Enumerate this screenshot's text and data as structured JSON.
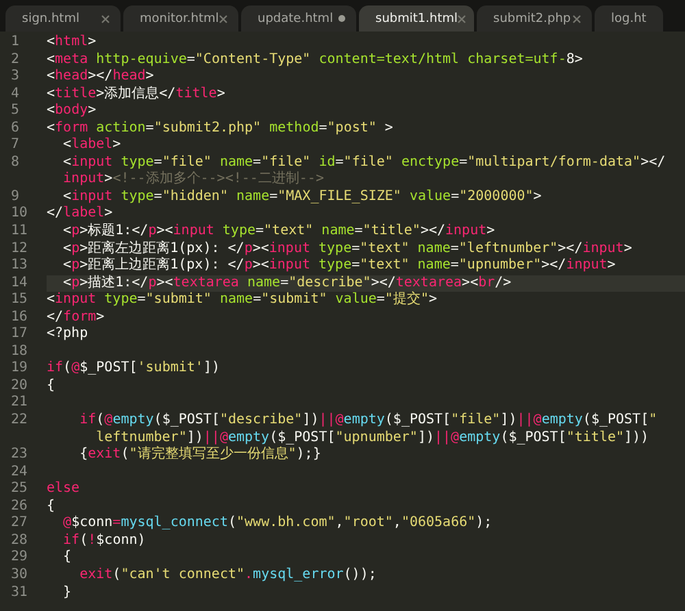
{
  "tabs": [
    {
      "label": "sign.html",
      "selected": false,
      "modified": false
    },
    {
      "label": "monitor.html",
      "selected": false,
      "modified": false
    },
    {
      "label": "update.html",
      "selected": false,
      "modified": true
    },
    {
      "label": "submit1.html",
      "selected": true,
      "modified": false
    },
    {
      "label": "submit2.php",
      "selected": false,
      "modified": false
    },
    {
      "label": "log.ht",
      "selected": false,
      "kind": "cut"
    }
  ],
  "lines": [
    {
      "number": "1",
      "current": false,
      "tokens": [
        {
          "kind": "p",
          "text": "<"
        },
        {
          "kind": "tag",
          "text": "html"
        },
        {
          "kind": "p",
          "text": ">"
        }
      ]
    },
    {
      "number": "2",
      "current": false,
      "tokens": [
        {
          "kind": "p",
          "text": "<"
        },
        {
          "kind": "tag",
          "text": "meta"
        },
        {
          "kind": "attr",
          "text": " http-equive"
        },
        {
          "kind": "p",
          "text": "="
        },
        {
          "kind": "str",
          "text": "\"Content-Type\""
        },
        {
          "kind": "attr",
          "text": " content=text/html charset=utf-"
        },
        {
          "kind": "p",
          "text": "8>"
        }
      ]
    },
    {
      "number": "3",
      "current": false,
      "tokens": [
        {
          "kind": "p",
          "text": "<"
        },
        {
          "kind": "tag",
          "text": "head"
        },
        {
          "kind": "p",
          "text": "></"
        },
        {
          "kind": "tag",
          "text": "head"
        },
        {
          "kind": "p",
          "text": ">"
        }
      ]
    },
    {
      "number": "4",
      "current": false,
      "tokens": [
        {
          "kind": "p",
          "text": "<"
        },
        {
          "kind": "tag",
          "text": "title"
        },
        {
          "kind": "p",
          "text": ">添加信息</"
        },
        {
          "kind": "tag",
          "text": "title"
        },
        {
          "kind": "p",
          "text": ">"
        }
      ]
    },
    {
      "number": "5",
      "current": false,
      "tokens": [
        {
          "kind": "p",
          "text": "<"
        },
        {
          "kind": "tag",
          "text": "body"
        },
        {
          "kind": "p",
          "text": ">"
        }
      ]
    },
    {
      "number": "6",
      "current": false,
      "tokens": [
        {
          "kind": "p",
          "text": "<"
        },
        {
          "kind": "tag",
          "text": "form"
        },
        {
          "kind": "attr",
          "text": " action"
        },
        {
          "kind": "p",
          "text": "="
        },
        {
          "kind": "str",
          "text": "\"submit2.php\""
        },
        {
          "kind": "attr",
          "text": " method"
        },
        {
          "kind": "p",
          "text": "="
        },
        {
          "kind": "str",
          "text": "\"post\""
        },
        {
          "kind": "p",
          "text": " >"
        }
      ]
    },
    {
      "number": "7",
      "current": false,
      "tokens": [
        {
          "kind": "p",
          "text": "  <"
        },
        {
          "kind": "tag",
          "text": "label"
        },
        {
          "kind": "p",
          "text": ">"
        }
      ]
    },
    {
      "number": "8",
      "current": false,
      "tokens": [
        {
          "kind": "p",
          "text": "  <"
        },
        {
          "kind": "tag",
          "text": "input"
        },
        {
          "kind": "attr",
          "text": " type"
        },
        {
          "kind": "p",
          "text": "="
        },
        {
          "kind": "str",
          "text": "\"file\""
        },
        {
          "kind": "attr",
          "text": " name"
        },
        {
          "kind": "p",
          "text": "="
        },
        {
          "kind": "str",
          "text": "\"file\""
        },
        {
          "kind": "attr",
          "text": " id"
        },
        {
          "kind": "p",
          "text": "="
        },
        {
          "kind": "str",
          "text": "\"file\""
        },
        {
          "kind": "attr",
          "text": " enctype"
        },
        {
          "kind": "p",
          "text": "="
        },
        {
          "kind": "str",
          "text": "\"multipart/form-data\""
        },
        {
          "kind": "p",
          "text": "></"
        }
      ],
      "wrap": [
        {
          "kind": "tag",
          "text": "  input"
        },
        {
          "kind": "p",
          "text": ">"
        },
        {
          "kind": "cmt",
          "text": "<!--添加多个--><!--二进制-->"
        }
      ]
    },
    {
      "number": "9",
      "current": false,
      "tokens": [
        {
          "kind": "p",
          "text": "  <"
        },
        {
          "kind": "tag",
          "text": "input"
        },
        {
          "kind": "attr",
          "text": " type"
        },
        {
          "kind": "p",
          "text": "="
        },
        {
          "kind": "str",
          "text": "\"hidden\""
        },
        {
          "kind": "attr",
          "text": " name"
        },
        {
          "kind": "p",
          "text": "="
        },
        {
          "kind": "str",
          "text": "\"MAX_FILE_SIZE\""
        },
        {
          "kind": "attr",
          "text": " value"
        },
        {
          "kind": "p",
          "text": "="
        },
        {
          "kind": "str",
          "text": "\"2000000\""
        },
        {
          "kind": "p",
          "text": ">"
        }
      ]
    },
    {
      "number": "10",
      "current": false,
      "tokens": [
        {
          "kind": "p",
          "text": "</"
        },
        {
          "kind": "tag",
          "text": "label"
        },
        {
          "kind": "p",
          "text": ">"
        }
      ]
    },
    {
      "number": "11",
      "current": false,
      "tokens": [
        {
          "kind": "p",
          "text": "  <"
        },
        {
          "kind": "tag",
          "text": "p"
        },
        {
          "kind": "p",
          "text": ">标题1:</"
        },
        {
          "kind": "tag",
          "text": "p"
        },
        {
          "kind": "p",
          "text": "><"
        },
        {
          "kind": "tag",
          "text": "input"
        },
        {
          "kind": "attr",
          "text": " type"
        },
        {
          "kind": "p",
          "text": "="
        },
        {
          "kind": "str",
          "text": "\"text\""
        },
        {
          "kind": "attr",
          "text": " name"
        },
        {
          "kind": "p",
          "text": "="
        },
        {
          "kind": "str",
          "text": "\"title\""
        },
        {
          "kind": "p",
          "text": "></"
        },
        {
          "kind": "tag",
          "text": "input"
        },
        {
          "kind": "p",
          "text": ">"
        }
      ]
    },
    {
      "number": "12",
      "current": false,
      "tokens": [
        {
          "kind": "p",
          "text": "  <"
        },
        {
          "kind": "tag",
          "text": "p"
        },
        {
          "kind": "p",
          "text": ">距离左边距离1(px): </"
        },
        {
          "kind": "tag",
          "text": "p"
        },
        {
          "kind": "p",
          "text": "><"
        },
        {
          "kind": "tag",
          "text": "input"
        },
        {
          "kind": "attr",
          "text": " type"
        },
        {
          "kind": "p",
          "text": "="
        },
        {
          "kind": "str",
          "text": "\"text\""
        },
        {
          "kind": "attr",
          "text": " name"
        },
        {
          "kind": "p",
          "text": "="
        },
        {
          "kind": "str",
          "text": "\"leftnumber\""
        },
        {
          "kind": "p",
          "text": "></"
        },
        {
          "kind": "tag",
          "text": "input"
        },
        {
          "kind": "p",
          "text": ">"
        }
      ]
    },
    {
      "number": "13",
      "current": false,
      "tokens": [
        {
          "kind": "p",
          "text": "  <"
        },
        {
          "kind": "tag",
          "text": "p"
        },
        {
          "kind": "p",
          "text": ">距离上边距离1(px): </"
        },
        {
          "kind": "tag",
          "text": "p"
        },
        {
          "kind": "p",
          "text": "><"
        },
        {
          "kind": "tag",
          "text": "input"
        },
        {
          "kind": "attr",
          "text": " type"
        },
        {
          "kind": "p",
          "text": "="
        },
        {
          "kind": "str",
          "text": "\"text\""
        },
        {
          "kind": "attr",
          "text": " name"
        },
        {
          "kind": "p",
          "text": "="
        },
        {
          "kind": "str",
          "text": "\"upnumber\""
        },
        {
          "kind": "p",
          "text": "></"
        },
        {
          "kind": "tag",
          "text": "input"
        },
        {
          "kind": "p",
          "text": ">"
        }
      ]
    },
    {
      "number": "14",
      "current": true,
      "tokens": [
        {
          "kind": "p",
          "text": "  <"
        },
        {
          "kind": "tag",
          "text": "p"
        },
        {
          "kind": "p",
          "text": ">描述1:</"
        },
        {
          "kind": "tag",
          "text": "p"
        },
        {
          "kind": "p",
          "text": "><"
        },
        {
          "kind": "tag",
          "text": "textarea"
        },
        {
          "kind": "attr",
          "text": " name"
        },
        {
          "kind": "p",
          "text": "="
        },
        {
          "kind": "str",
          "text": "\"describe\""
        },
        {
          "kind": "p",
          "text": "></"
        },
        {
          "kind": "tag",
          "text": "textarea"
        },
        {
          "kind": "p",
          "text": "><"
        },
        {
          "kind": "tag",
          "text": "br"
        },
        {
          "kind": "p",
          "text": "/>"
        }
      ]
    },
    {
      "number": "15",
      "current": false,
      "tokens": [
        {
          "kind": "p",
          "text": "<"
        },
        {
          "kind": "tag",
          "text": "input"
        },
        {
          "kind": "attr",
          "text": " type"
        },
        {
          "kind": "p",
          "text": "="
        },
        {
          "kind": "str",
          "text": "\"submit\""
        },
        {
          "kind": "attr",
          "text": " name"
        },
        {
          "kind": "p",
          "text": "="
        },
        {
          "kind": "str",
          "text": "\"submit\""
        },
        {
          "kind": "attr",
          "text": " value"
        },
        {
          "kind": "p",
          "text": "="
        },
        {
          "kind": "str",
          "text": "\"提交\""
        },
        {
          "kind": "p",
          "text": ">"
        }
      ]
    },
    {
      "number": "16",
      "current": false,
      "tokens": [
        {
          "kind": "p",
          "text": "</"
        },
        {
          "kind": "tag",
          "text": "form"
        },
        {
          "kind": "p",
          "text": ">"
        }
      ]
    },
    {
      "number": "17",
      "current": false,
      "tokens": [
        {
          "kind": "p",
          "text": "<?php"
        }
      ]
    },
    {
      "number": "18",
      "current": false
    },
    {
      "number": "19",
      "current": false,
      "tokens": [
        {
          "kind": "kw",
          "text": "if"
        },
        {
          "kind": "p",
          "text": "("
        },
        {
          "kind": "kw",
          "text": "@"
        },
        {
          "kind": "p",
          "text": "$_POST["
        },
        {
          "kind": "str",
          "text": "'submit'"
        },
        {
          "kind": "p",
          "text": "])"
        }
      ]
    },
    {
      "number": "20",
      "current": false,
      "tokens": [
        {
          "kind": "p",
          "text": "{"
        }
      ]
    },
    {
      "number": "21",
      "current": false
    },
    {
      "number": "22",
      "current": false,
      "tokens": [
        {
          "kind": "kw",
          "text": "    if"
        },
        {
          "kind": "p",
          "text": "("
        },
        {
          "kind": "kw",
          "text": "@"
        },
        {
          "kind": "fn",
          "text": "empty"
        },
        {
          "kind": "p",
          "text": "($_POST["
        },
        {
          "kind": "str",
          "text": "\"describe\""
        },
        {
          "kind": "p",
          "text": "])"
        },
        {
          "kind": "kw",
          "text": "||@"
        },
        {
          "kind": "fn",
          "text": "empty"
        },
        {
          "kind": "p",
          "text": "($_POST["
        },
        {
          "kind": "str",
          "text": "\"file\""
        },
        {
          "kind": "p",
          "text": "])"
        },
        {
          "kind": "kw",
          "text": "||@"
        },
        {
          "kind": "fn",
          "text": "empty"
        },
        {
          "kind": "p",
          "text": "($_POST["
        },
        {
          "kind": "str",
          "text": "\""
        }
      ],
      "wrap": [
        {
          "kind": "str",
          "text": "      leftnumber\""
        },
        {
          "kind": "p",
          "text": "])"
        },
        {
          "kind": "kw",
          "text": "||@"
        },
        {
          "kind": "fn",
          "text": "empty"
        },
        {
          "kind": "p",
          "text": "($_POST["
        },
        {
          "kind": "str",
          "text": "\"upnumber\""
        },
        {
          "kind": "p",
          "text": "])"
        },
        {
          "kind": "kw",
          "text": "||@"
        },
        {
          "kind": "fn",
          "text": "empty"
        },
        {
          "kind": "p",
          "text": "($_POST["
        },
        {
          "kind": "str",
          "text": "\"title\""
        },
        {
          "kind": "p",
          "text": "]))"
        }
      ]
    },
    {
      "number": "23",
      "current": false,
      "tokens": [
        {
          "kind": "p",
          "text": "    {"
        },
        {
          "kind": "kw",
          "text": "exit"
        },
        {
          "kind": "p",
          "text": "("
        },
        {
          "kind": "str",
          "text": "\"请完整填写至少一份信息\""
        },
        {
          "kind": "p",
          "text": ");}"
        }
      ]
    },
    {
      "number": "24",
      "current": false
    },
    {
      "number": "25",
      "current": false,
      "tokens": [
        {
          "kind": "kw",
          "text": "else"
        }
      ]
    },
    {
      "number": "26",
      "current": false,
      "tokens": [
        {
          "kind": "p",
          "text": "{"
        }
      ]
    },
    {
      "number": "27",
      "current": false,
      "tokens": [
        {
          "kind": "kw",
          "text": "  @"
        },
        {
          "kind": "p",
          "text": "$conn"
        },
        {
          "kind": "kw",
          "text": "="
        },
        {
          "kind": "fn",
          "text": "mysql_connect"
        },
        {
          "kind": "p",
          "text": "("
        },
        {
          "kind": "str",
          "text": "\"www.bh.com\""
        },
        {
          "kind": "p",
          "text": ","
        },
        {
          "kind": "str",
          "text": "\"root\""
        },
        {
          "kind": "p",
          "text": ","
        },
        {
          "kind": "str",
          "text": "\"0605a66\""
        },
        {
          "kind": "p",
          "text": ");"
        }
      ]
    },
    {
      "number": "28",
      "current": false,
      "tokens": [
        {
          "kind": "kw",
          "text": "  if"
        },
        {
          "kind": "p",
          "text": "("
        },
        {
          "kind": "kw",
          "text": "!"
        },
        {
          "kind": "p",
          "text": "$conn)"
        }
      ]
    },
    {
      "number": "29",
      "current": false,
      "tokens": [
        {
          "kind": "p",
          "text": "  {"
        }
      ]
    },
    {
      "number": "30",
      "current": false,
      "tokens": [
        {
          "kind": "kw",
          "text": "    exit"
        },
        {
          "kind": "p",
          "text": "("
        },
        {
          "kind": "str",
          "text": "\"can't connect\""
        },
        {
          "kind": "kw",
          "text": "."
        },
        {
          "kind": "fn",
          "text": "mysql_error"
        },
        {
          "kind": "p",
          "text": "());"
        }
      ]
    },
    {
      "number": "31",
      "current": false,
      "tokens": [
        {
          "kind": "p",
          "text": "  }"
        }
      ]
    }
  ]
}
